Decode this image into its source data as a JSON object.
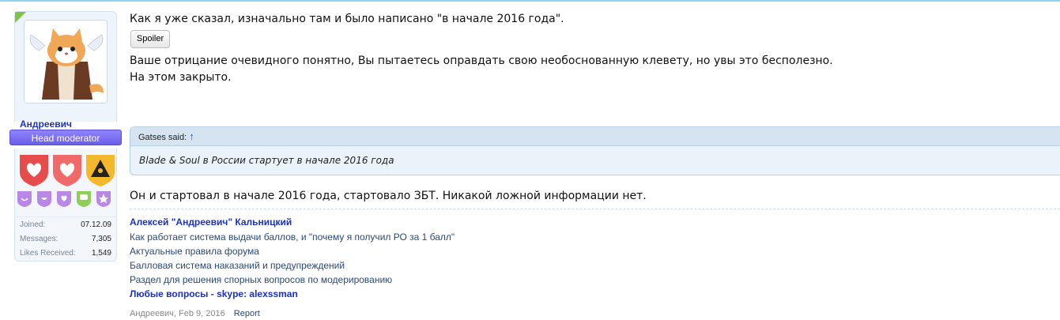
{
  "user": {
    "name": "Андреевич",
    "title": "Head moderator",
    "stats": [
      {
        "label": "Joined:",
        "value": "07.12.09"
      },
      {
        "label": "Messages:",
        "value": "7,305"
      },
      {
        "label": "Likes Received:",
        "value": "1,549"
      }
    ],
    "medal_colors": [
      "#e74c4c",
      "#f06a6a",
      "#f3b82b",
      "#b987e6",
      "#b987e6",
      "#b987e6",
      "#8fcf57",
      "#b987e6"
    ]
  },
  "post": {
    "line1": "Как я уже сказал, изначально там и было написано \"в начале 2016 года\".",
    "spoiler_label": "Spoiler",
    "line2": "Ваше отрицание очевидного понятно, Вы пытаетесь оправдать свою необоснованную клевету, но увы это бесполезно.",
    "line3": "На этом закрыто.",
    "quote": {
      "author": "Gatses said:",
      "arrow": "↑",
      "text": "Blade & Soul в России стартует в начале 2016 года"
    },
    "line4": "Он и стартовал в начале 2016 года, стартовало ЗБТ. Никакой ложной информации нет."
  },
  "signature": {
    "name": "Алексей \"Андреевич\" Кальницкий",
    "links": [
      "Как работает система выдачи баллов, и \"почему я получил РО за 1 балл\"",
      "Актуальные правила форума",
      "Балловая система наказаний и предупреждений",
      "Раздел для решения спорных вопросов по модерированию"
    ],
    "contact": "Любые вопросы - skype: alexssman"
  },
  "meta": {
    "author_date": "Андреевич, Feb 9, 2016",
    "report_label": "Report"
  }
}
